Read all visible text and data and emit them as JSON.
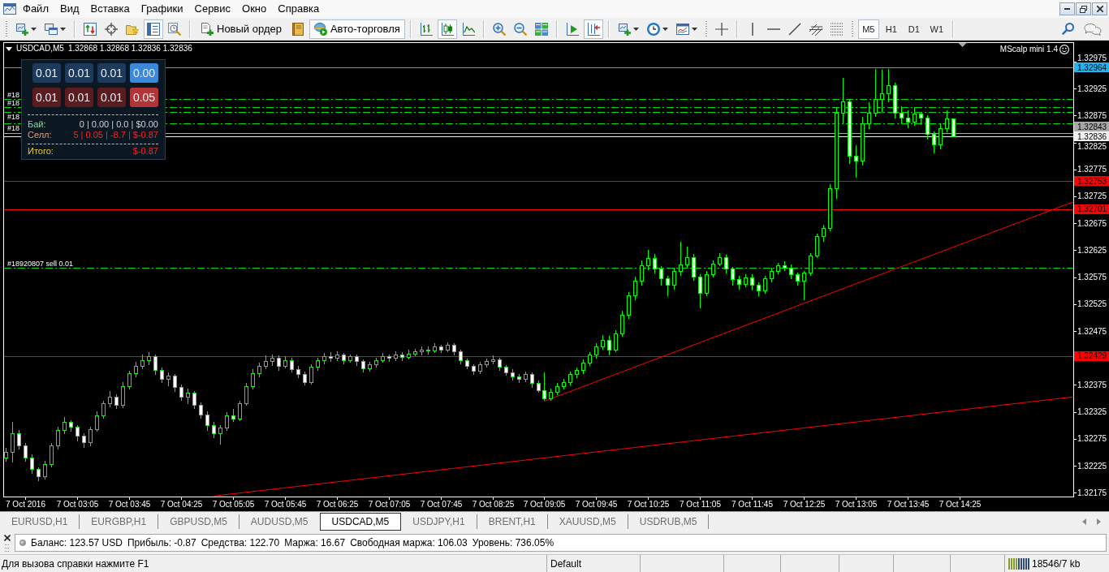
{
  "menu": [
    "Файл",
    "Вид",
    "Вставка",
    "Графики",
    "Сервис",
    "Окно",
    "Справка"
  ],
  "toolbar": {
    "window_tools": [
      {
        "pressed": false
      },
      {
        "pressed": false
      },
      {
        "pressed": false
      },
      {
        "pressed": true
      },
      {
        "pressed": false
      }
    ],
    "new_order": {
      "label": "Новый ордер"
    },
    "auto_trading": {
      "label": "Авто-торговля",
      "pressed": true
    },
    "chart_types": [
      {
        "selected": false
      },
      {
        "selected": true
      },
      {
        "selected": false
      }
    ],
    "chart_tools": [
      {
        "pressed": false
      },
      {
        "pressed": true
      }
    ],
    "periods": [
      {
        "label": "M5",
        "selected": true
      },
      {
        "label": "H1",
        "selected": false
      },
      {
        "label": "D1",
        "selected": false
      },
      {
        "label": "W1",
        "selected": false
      }
    ]
  },
  "chart": {
    "symbol": "USDCAD,M5",
    "quote": "1.32868 1.32868 1.32836 1.32836",
    "indicator": "MScalp mini 1.4",
    "trade_panel": {
      "buy_lots": [
        {
          "label": "0.01",
          "selected": false
        },
        {
          "label": "0.01",
          "selected": false
        },
        {
          "label": "0.01",
          "selected": false
        },
        {
          "label": "0.00",
          "selected": true
        }
      ],
      "sell_lots": [
        {
          "label": "0.01",
          "selected": false
        },
        {
          "label": "0.01",
          "selected": false
        },
        {
          "label": "0.01",
          "selected": false
        },
        {
          "label": "0.05",
          "selected": true
        }
      ],
      "rows": [
        {
          "kind": "buy",
          "label": "Бай:",
          "value": "0 | 0.00 | 0.0 | $0.00"
        },
        {
          "kind": "sell",
          "label": "Селл:",
          "value": "5 | 0.05 | -8.7 | $-0.87"
        },
        {
          "kind": "total",
          "label": "Итого:",
          "value": "$-0.87"
        }
      ]
    },
    "chart_data": [
      {
        "type": "candlestick",
        "x": [
          "2016-10-07T02:10",
          "2016-10-07T02:15",
          "2016-10-07T02:20",
          "2016-10-07T02:25",
          "2016-10-07T02:30",
          "2016-10-07T02:35",
          "2016-10-07T02:40",
          "2016-10-07T02:45",
          "2016-10-07T02:50",
          "2016-10-07T02:55",
          "2016-10-07T03:00",
          "2016-10-07T03:05",
          "2016-10-07T03:10",
          "2016-10-07T03:15",
          "2016-10-07T03:20",
          "2016-10-07T03:25",
          "2016-10-07T03:30",
          "2016-10-07T03:35",
          "2016-10-07T03:40",
          "2016-10-07T03:45",
          "2016-10-07T03:50",
          "2016-10-07T03:55",
          "2016-10-07T04:00",
          "2016-10-07T04:05",
          "2016-10-07T04:10",
          "2016-10-07T04:15",
          "2016-10-07T04:20",
          "2016-10-07T04:25",
          "2016-10-07T04:30",
          "2016-10-07T04:35",
          "2016-10-07T04:40",
          "2016-10-07T04:45",
          "2016-10-07T04:50",
          "2016-10-07T04:55",
          "2016-10-07T05:00",
          "2016-10-07T05:05",
          "2016-10-07T05:10",
          "2016-10-07T05:15",
          "2016-10-07T05:20",
          "2016-10-07T05:25",
          "2016-10-07T05:30",
          "2016-10-07T05:35",
          "2016-10-07T05:40",
          "2016-10-07T05:45",
          "2016-10-07T05:50",
          "2016-10-07T05:55",
          "2016-10-07T06:00",
          "2016-10-07T06:05",
          "2016-10-07T06:10",
          "2016-10-07T06:15",
          "2016-10-07T06:20",
          "2016-10-07T06:25",
          "2016-10-07T06:30",
          "2016-10-07T06:35",
          "2016-10-07T06:40",
          "2016-10-07T06:45",
          "2016-10-07T06:50",
          "2016-10-07T06:55",
          "2016-10-07T07:00",
          "2016-10-07T07:05",
          "2016-10-07T07:10",
          "2016-10-07T07:15",
          "2016-10-07T07:20",
          "2016-10-07T07:25",
          "2016-10-07T07:30",
          "2016-10-07T07:35",
          "2016-10-07T07:40",
          "2016-10-07T07:45",
          "2016-10-07T07:50",
          "2016-10-07T07:55",
          "2016-10-07T08:00",
          "2016-10-07T08:05",
          "2016-10-07T08:10",
          "2016-10-07T08:15",
          "2016-10-07T08:20",
          "2016-10-07T08:25",
          "2016-10-07T08:30",
          "2016-10-07T08:35",
          "2016-10-07T08:40",
          "2016-10-07T08:45",
          "2016-10-07T08:50",
          "2016-10-07T08:55",
          "2016-10-07T09:00",
          "2016-10-07T09:05",
          "2016-10-07T09:10",
          "2016-10-07T09:15",
          "2016-10-07T09:20",
          "2016-10-07T09:25",
          "2016-10-07T09:30",
          "2016-10-07T09:35",
          "2016-10-07T09:40",
          "2016-10-07T09:45",
          "2016-10-07T09:50",
          "2016-10-07T09:55",
          "2016-10-07T10:00",
          "2016-10-07T10:05",
          "2016-10-07T10:10",
          "2016-10-07T10:15",
          "2016-10-07T10:20",
          "2016-10-07T10:25",
          "2016-10-07T10:30",
          "2016-10-07T10:35",
          "2016-10-07T10:40",
          "2016-10-07T10:45",
          "2016-10-07T10:50",
          "2016-10-07T10:55",
          "2016-10-07T11:00",
          "2016-10-07T11:05",
          "2016-10-07T11:10",
          "2016-10-07T11:15",
          "2016-10-07T11:20",
          "2016-10-07T11:25",
          "2016-10-07T11:30",
          "2016-10-07T11:35",
          "2016-10-07T11:40",
          "2016-10-07T11:45",
          "2016-10-07T11:50",
          "2016-10-07T11:55",
          "2016-10-07T12:00",
          "2016-10-07T12:05",
          "2016-10-07T12:10",
          "2016-10-07T12:15",
          "2016-10-07T12:20",
          "2016-10-07T12:25",
          "2016-10-07T12:30",
          "2016-10-07T12:35",
          "2016-10-07T12:40",
          "2016-10-07T12:45",
          "2016-10-07T12:50",
          "2016-10-07T12:55",
          "2016-10-07T13:00",
          "2016-10-07T13:05",
          "2016-10-07T13:10",
          "2016-10-07T13:15",
          "2016-10-07T13:20",
          "2016-10-07T13:25",
          "2016-10-07T13:30",
          "2016-10-07T13:35",
          "2016-10-07T13:40",
          "2016-10-07T13:45",
          "2016-10-07T13:50",
          "2016-10-07T13:55",
          "2016-10-07T14:00",
          "2016-10-07T14:05",
          "2016-10-07T14:10",
          "2016-10-07T14:15",
          "2016-10-07T14:20"
        ],
        "ohlc": [
          [
            1.3224,
            1.32258,
            1.32232,
            1.3225
          ],
          [
            1.3225,
            1.32306,
            1.32231,
            1.32285
          ],
          [
            1.32285,
            1.32292,
            1.32255,
            1.32262
          ],
          [
            1.32262,
            1.32268,
            1.32233,
            1.3224
          ],
          [
            1.3224,
            1.32246,
            1.3221,
            1.32218
          ],
          [
            1.32218,
            1.32222,
            1.32196,
            1.32205
          ],
          [
            1.32205,
            1.32234,
            1.32199,
            1.32228
          ],
          [
            1.32228,
            1.32268,
            1.32222,
            1.32262
          ],
          [
            1.32262,
            1.32298,
            1.32255,
            1.3229
          ],
          [
            1.3229,
            1.32316,
            1.32284,
            1.32305
          ],
          [
            1.32305,
            1.3231,
            1.32288,
            1.32296
          ],
          [
            1.32296,
            1.323,
            1.3227,
            1.3228
          ],
          [
            1.3228,
            1.32286,
            1.32258,
            1.32268
          ],
          [
            1.32268,
            1.32298,
            1.32262,
            1.32292
          ],
          [
            1.32292,
            1.32326,
            1.32288,
            1.32318
          ],
          [
            1.32318,
            1.32346,
            1.32312,
            1.3234
          ],
          [
            1.3234,
            1.32364,
            1.32334,
            1.32352
          ],
          [
            1.32352,
            1.32358,
            1.3233,
            1.32338
          ],
          [
            1.32338,
            1.3238,
            1.32332,
            1.32372
          ],
          [
            1.32372,
            1.32402,
            1.32366,
            1.32396
          ],
          [
            1.32396,
            1.32418,
            1.3239,
            1.3241
          ],
          [
            1.3241,
            1.32432,
            1.32404,
            1.3242
          ],
          [
            1.3242,
            1.32436,
            1.32412,
            1.32428
          ],
          [
            1.32428,
            1.32432,
            1.32394,
            1.32402
          ],
          [
            1.32402,
            1.32408,
            1.32378,
            1.32385
          ],
          [
            1.32385,
            1.32398,
            1.32372,
            1.32392
          ],
          [
            1.32392,
            1.32396,
            1.32362,
            1.3237
          ],
          [
            1.3237,
            1.32376,
            1.32346,
            1.32352
          ],
          [
            1.32352,
            1.32368,
            1.3234,
            1.3236
          ],
          [
            1.3236,
            1.32364,
            1.3233,
            1.32338
          ],
          [
            1.32338,
            1.32342,
            1.32312,
            1.3232
          ],
          [
            1.3232,
            1.32326,
            1.3229,
            1.323
          ],
          [
            1.323,
            1.32306,
            1.32276,
            1.32285
          ],
          [
            1.32285,
            1.323,
            1.32264,
            1.32295
          ],
          [
            1.32295,
            1.32324,
            1.3229,
            1.32318
          ],
          [
            1.32318,
            1.3233,
            1.32306,
            1.32312
          ],
          [
            1.32312,
            1.32346,
            1.32308,
            1.3234
          ],
          [
            1.3234,
            1.32378,
            1.32336,
            1.32372
          ],
          [
            1.32372,
            1.32404,
            1.32366,
            1.32396
          ],
          [
            1.32396,
            1.32416,
            1.3239,
            1.3241
          ],
          [
            1.3241,
            1.3243,
            1.32404,
            1.32418
          ],
          [
            1.32418,
            1.32432,
            1.3241,
            1.32425
          ],
          [
            1.32425,
            1.3243,
            1.32402,
            1.3241
          ],
          [
            1.3241,
            1.32428,
            1.32406,
            1.3242
          ],
          [
            1.3242,
            1.32426,
            1.32398,
            1.32404
          ],
          [
            1.32404,
            1.3241,
            1.32388,
            1.32395
          ],
          [
            1.32395,
            1.324,
            1.32374,
            1.3238
          ],
          [
            1.3238,
            1.32414,
            1.32376,
            1.32408
          ],
          [
            1.32408,
            1.32426,
            1.32402,
            1.3242
          ],
          [
            1.3242,
            1.32434,
            1.32414,
            1.32428
          ],
          [
            1.32428,
            1.32436,
            1.32418,
            1.32425
          ],
          [
            1.32425,
            1.32438,
            1.3242,
            1.3243
          ],
          [
            1.3243,
            1.32434,
            1.32414,
            1.3242
          ],
          [
            1.3242,
            1.32432,
            1.32416,
            1.32428
          ],
          [
            1.32428,
            1.32432,
            1.3241,
            1.32418
          ],
          [
            1.32418,
            1.32422,
            1.32398,
            1.32405
          ],
          [
            1.32405,
            1.32418,
            1.324,
            1.32412
          ],
          [
            1.32412,
            1.32426,
            1.32408,
            1.3242
          ],
          [
            1.3242,
            1.32434,
            1.32416,
            1.32428
          ],
          [
            1.32428,
            1.32432,
            1.32418,
            1.32424
          ],
          [
            1.32424,
            1.32438,
            1.3242,
            1.32431
          ],
          [
            1.32431,
            1.32436,
            1.3242,
            1.32426
          ],
          [
            1.32426,
            1.3244,
            1.32422,
            1.32432
          ],
          [
            1.32432,
            1.32442,
            1.32428,
            1.32436
          ],
          [
            1.32436,
            1.32446,
            1.3243,
            1.3244
          ],
          [
            1.3244,
            1.32446,
            1.32432,
            1.32438
          ],
          [
            1.32438,
            1.32452,
            1.32434,
            1.32445
          ],
          [
            1.32445,
            1.3245,
            1.32434,
            1.3244
          ],
          [
            1.3244,
            1.32454,
            1.32436,
            1.32448
          ],
          [
            1.32448,
            1.32452,
            1.3243,
            1.32436
          ],
          [
            1.32436,
            1.3244,
            1.32414,
            1.3242
          ],
          [
            1.3242,
            1.32424,
            1.32404,
            1.3241
          ],
          [
            1.3241,
            1.32414,
            1.32394,
            1.324
          ],
          [
            1.324,
            1.32418,
            1.32396,
            1.32412
          ],
          [
            1.32412,
            1.32424,
            1.32408,
            1.32418
          ],
          [
            1.32418,
            1.3243,
            1.32414,
            1.32422
          ],
          [
            1.32422,
            1.32426,
            1.32402,
            1.32408
          ],
          [
            1.32408,
            1.32412,
            1.32392,
            1.32398
          ],
          [
            1.32398,
            1.32404,
            1.32384,
            1.3239
          ],
          [
            1.3239,
            1.32396,
            1.32378,
            1.32385
          ],
          [
            1.32385,
            1.324,
            1.3238,
            1.32395
          ],
          [
            1.32395,
            1.32398,
            1.3237,
            1.32378
          ],
          [
            1.32378,
            1.32384,
            1.3236,
            1.32365
          ],
          [
            1.32365,
            1.32398,
            1.32345,
            1.3235
          ],
          [
            1.3235,
            1.32368,
            1.32346,
            1.32362
          ],
          [
            1.32362,
            1.32378,
            1.32356,
            1.32372
          ],
          [
            1.32372,
            1.32386,
            1.32366,
            1.3238
          ],
          [
            1.3238,
            1.324,
            1.32374,
            1.32395
          ],
          [
            1.32395,
            1.32408,
            1.32388,
            1.32402
          ],
          [
            1.32402,
            1.32422,
            1.32396,
            1.32415
          ],
          [
            1.32415,
            1.32436,
            1.3241,
            1.3243
          ],
          [
            1.3243,
            1.32452,
            1.32424,
            1.32446
          ],
          [
            1.32446,
            1.32468,
            1.3244,
            1.32458
          ],
          [
            1.32458,
            1.32466,
            1.3243,
            1.3244
          ],
          [
            1.3244,
            1.32476,
            1.32436,
            1.3247
          ],
          [
            1.3247,
            1.32512,
            1.32464,
            1.32505
          ],
          [
            1.32505,
            1.32548,
            1.32498,
            1.3254
          ],
          [
            1.3254,
            1.32576,
            1.32532,
            1.32568
          ],
          [
            1.32568,
            1.32606,
            1.3256,
            1.32596
          ],
          [
            1.32596,
            1.32626,
            1.32588,
            1.3261
          ],
          [
            1.3261,
            1.32618,
            1.32582,
            1.3259
          ],
          [
            1.3259,
            1.32596,
            1.3256,
            1.32572
          ],
          [
            1.32572,
            1.32578,
            1.3254,
            1.3256
          ],
          [
            1.3256,
            1.32592,
            1.32552,
            1.32585
          ],
          [
            1.32585,
            1.3264,
            1.32578,
            1.32598
          ],
          [
            1.32598,
            1.32632,
            1.32592,
            1.32612
          ],
          [
            1.32612,
            1.32618,
            1.32568,
            1.32575
          ],
          [
            1.32575,
            1.3258,
            1.32517,
            1.32545
          ],
          [
            1.32545,
            1.32586,
            1.3254,
            1.3258
          ],
          [
            1.3258,
            1.32606,
            1.32574,
            1.326
          ],
          [
            1.326,
            1.3262,
            1.32596,
            1.32612
          ],
          [
            1.32612,
            1.32616,
            1.32582,
            1.3259
          ],
          [
            1.3259,
            1.32594,
            1.3256,
            1.3257
          ],
          [
            1.3257,
            1.32578,
            1.32552,
            1.32562
          ],
          [
            1.32562,
            1.3258,
            1.32556,
            1.32574
          ],
          [
            1.32574,
            1.3258,
            1.3255,
            1.3256
          ],
          [
            1.3256,
            1.32566,
            1.3254,
            1.3255
          ],
          [
            1.3255,
            1.32578,
            1.32544,
            1.32572
          ],
          [
            1.32572,
            1.32592,
            1.32566,
            1.32586
          ],
          [
            1.32586,
            1.32602,
            1.3258,
            1.32596
          ],
          [
            1.32596,
            1.32604,
            1.32586,
            1.32592
          ],
          [
            1.32592,
            1.32598,
            1.32572,
            1.3258
          ],
          [
            1.3258,
            1.32584,
            1.3256,
            1.32568
          ],
          [
            1.32568,
            1.32586,
            1.32532,
            1.32582
          ],
          [
            1.32582,
            1.3262,
            1.32578,
            1.32615
          ],
          [
            1.32615,
            1.32656,
            1.3261,
            1.3265
          ],
          [
            1.3265,
            1.32672,
            1.3264,
            1.32665
          ],
          [
            1.32665,
            1.32748,
            1.3266,
            1.3274
          ],
          [
            1.3274,
            1.3289,
            1.3272,
            1.3288
          ],
          [
            1.3288,
            1.32945,
            1.3286,
            1.329
          ],
          [
            1.329,
            1.32906,
            1.32785,
            1.328
          ],
          [
            1.328,
            1.3282,
            1.3276,
            1.3279
          ],
          [
            1.3279,
            1.32872,
            1.32782,
            1.3286
          ],
          [
            1.3286,
            1.329,
            1.3285,
            1.3288
          ],
          [
            1.3288,
            1.32962,
            1.32872,
            1.32905
          ],
          [
            1.32905,
            1.3296,
            1.3288,
            1.32915
          ],
          [
            1.32915,
            1.32962,
            1.329,
            1.3293
          ],
          [
            1.3293,
            1.32936,
            1.3287,
            1.3288
          ],
          [
            1.3288,
            1.32892,
            1.3286,
            1.3287
          ],
          [
            1.3287,
            1.32884,
            1.32852,
            1.32862
          ],
          [
            1.32862,
            1.3289,
            1.32856,
            1.32878
          ],
          [
            1.32878,
            1.32882,
            1.32858,
            1.3287
          ],
          [
            1.3287,
            1.32876,
            1.3283,
            1.3284
          ],
          [
            1.3284,
            1.32846,
            1.32805,
            1.3282
          ],
          [
            1.3282,
            1.3286,
            1.32812,
            1.3285
          ],
          [
            1.3285,
            1.32884,
            1.32844,
            1.32868
          ],
          [
            1.32868,
            1.32868,
            1.32836,
            1.32836
          ]
        ],
        "series": [
          {
            "type": "line",
            "color": "#ff0000",
            "x": [
              "2016-10-07T09:05",
              "2016-10-07T15:52"
            ],
            "values": [
              1.32345,
              1.32715
            ]
          },
          {
            "type": "line",
            "color": "#ff0000",
            "x": [
              "2016-10-07T04:50",
              "2016-10-07T15:52"
            ],
            "values": [
              1.32169,
              1.32353
            ]
          }
        ],
        "xlim": [
          "2016-10-07T02:08",
          "2016-10-07T15:52"
        ],
        "ylim": [
          1.32168,
          1.33011
        ],
        "xticks": [
          {
            "value": "2016-10-07T02:25",
            "label": "7 Oct 2016"
          },
          {
            "value": "2016-10-07T03:05",
            "label": "7 Oct 03:05"
          },
          {
            "value": "2016-10-07T03:45",
            "label": "7 Oct 03:45"
          },
          {
            "value": "2016-10-07T04:25",
            "label": "7 Oct 04:25"
          },
          {
            "value": "2016-10-07T05:05",
            "label": "7 Oct 05:05"
          },
          {
            "value": "2016-10-07T05:45",
            "label": "7 Oct 05:45"
          },
          {
            "value": "2016-10-07T06:25",
            "label": "7 Oct 06:25"
          },
          {
            "value": "2016-10-07T07:05",
            "label": "7 Oct 07:05"
          },
          {
            "value": "2016-10-07T07:45",
            "label": "7 Oct 07:45"
          },
          {
            "value": "2016-10-07T08:25",
            "label": "7 Oct 08:25"
          },
          {
            "value": "2016-10-07T09:05",
            "label": "7 Oct 09:05"
          },
          {
            "value": "2016-10-07T09:45",
            "label": "7 Oct 09:45"
          },
          {
            "value": "2016-10-07T10:25",
            "label": "7 Oct 10:25"
          },
          {
            "value": "2016-10-07T11:05",
            "label": "7 Oct 11:05"
          },
          {
            "value": "2016-10-07T11:45",
            "label": "7 Oct 11:45"
          },
          {
            "value": "2016-10-07T12:25",
            "label": "7 Oct 12:25"
          },
          {
            "value": "2016-10-07T13:05",
            "label": "7 Oct 13:05"
          },
          {
            "value": "2016-10-07T13:45",
            "label": "7 Oct 13:45"
          },
          {
            "value": "2016-10-07T14:25",
            "label": "7 Oct 14:25"
          }
        ],
        "yticks": [
          {
            "value": 1.32975,
            "label": "1.32975"
          },
          {
            "value": 1.32925,
            "label": "1.32925"
          },
          {
            "value": 1.32875,
            "label": "1.32875"
          },
          {
            "value": 1.32825,
            "label": "1.32825"
          },
          {
            "value": 1.32775,
            "label": "1.32775"
          },
          {
            "value": 1.32725,
            "label": "1.32725"
          },
          {
            "value": 1.32675,
            "label": "1.32675"
          },
          {
            "value": 1.32625,
            "label": "1.32625"
          },
          {
            "value": 1.32575,
            "label": "1.32575"
          },
          {
            "value": 1.32525,
            "label": "1.32525"
          },
          {
            "value": 1.32475,
            "label": "1.32475"
          },
          {
            "value": 1.32375,
            "label": "1.32375"
          },
          {
            "value": 1.32325,
            "label": "1.32325"
          },
          {
            "value": 1.32275,
            "label": "1.32275"
          },
          {
            "value": 1.32225,
            "label": "1.32225"
          },
          {
            "value": 1.32175,
            "label": "1.32175"
          }
        ],
        "ref_lines": [
          {
            "axis": "y",
            "value": 1.32964,
            "label": "1.32964",
            "color": "#1eb4f0",
            "line_style": "solid"
          },
          {
            "axis": "y",
            "value": 1.32905,
            "color": "#00e000",
            "line_style": "dashdot"
          },
          {
            "axis": "y",
            "value": 1.3289,
            "color": "#00e000",
            "line_style": "dashdot"
          },
          {
            "axis": "y",
            "value": 1.32882,
            "color": "#00e000",
            "line_style": "dashdot"
          },
          {
            "axis": "y",
            "value": 1.3286,
            "color": "#00e000",
            "line_style": "dashdot"
          },
          {
            "axis": "y",
            "value": 1.32843,
            "label": "1.32843",
            "color": "#a8a8a8",
            "line_style": "solid"
          },
          {
            "axis": "y",
            "value": 1.32836,
            "label": "1.32836",
            "color": "#f0f0f0",
            "line_style": "solid"
          },
          {
            "axis": "y",
            "value": 1.32753,
            "label": "1.32753",
            "color": "#ff0000",
            "line_style": "solid"
          },
          {
            "axis": "y",
            "value": 1.32701,
            "label": "1.32701",
            "color": "#ff0000",
            "line_style": "solid"
          },
          {
            "axis": "y",
            "value": 1.32592,
            "color": "#00e000",
            "line_style": "dashdot"
          },
          {
            "axis": "y",
            "value": 1.32429,
            "label": "1.32429",
            "color": "#ff0000",
            "line_style": "solid"
          }
        ],
        "annotations": [
          "#18",
          "#18",
          "#18",
          "#18",
          "#18920807 sell 0.01"
        ]
      }
    ]
  },
  "chart_tabs": [
    {
      "label": "EURUSD,H1",
      "selected": false
    },
    {
      "label": "EURGBP,H1",
      "selected": false
    },
    {
      "label": "GBPUSD,M5",
      "selected": false
    },
    {
      "label": "AUDUSD,M5",
      "selected": false
    },
    {
      "label": "USDCAD,M5",
      "selected": true
    },
    {
      "label": "USDJPY,H1",
      "selected": false
    },
    {
      "label": "BRENT,H1",
      "selected": false
    },
    {
      "label": "XAUUSD,M5",
      "selected": false
    },
    {
      "label": "USDRUB,M5",
      "selected": false
    }
  ],
  "account_bar": {
    "items": [
      "Баланс: 123.57 USD",
      "Прибыль: -0.87",
      "Средства: 122.70",
      "Маржа: 16.67",
      "Свободная маржа: 106.03",
      "Уровень: 736.05%"
    ]
  },
  "status_bar": {
    "help": "Для вызова справки нажмите F1",
    "profile": "Default",
    "traffic": "18546/7 kb"
  }
}
